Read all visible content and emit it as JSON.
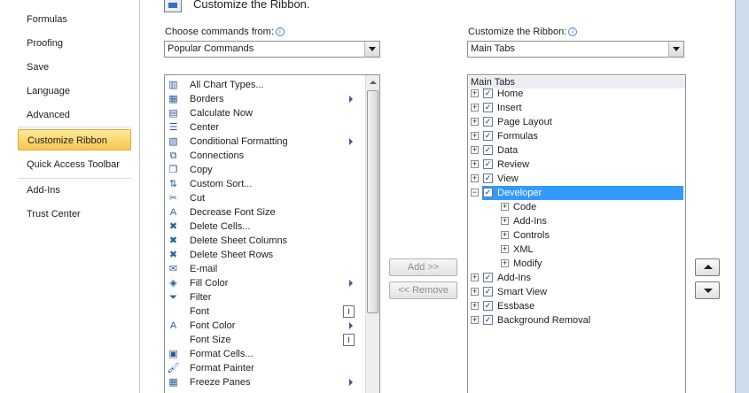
{
  "nav": {
    "items": [
      {
        "label": "Formulas"
      },
      {
        "label": "Proofing"
      },
      {
        "label": "Save"
      },
      {
        "label": "Language"
      },
      {
        "label": "Advanced"
      },
      {
        "label": "Customize Ribbon"
      },
      {
        "label": "Quick Access Toolbar"
      },
      {
        "label": "Add-Ins"
      },
      {
        "label": "Trust Center"
      }
    ]
  },
  "header": {
    "title": "Customize the Ribbon."
  },
  "left": {
    "label": "Choose commands from:",
    "combo_value": "Popular Commands",
    "commands": [
      {
        "label": "All Chart Types...",
        "icon": "chart-icon",
        "glyph": "▥",
        "suffix": ""
      },
      {
        "label": "Borders",
        "icon": "borders-icon",
        "glyph": "▦",
        "suffix": "arrow"
      },
      {
        "label": "Calculate Now",
        "icon": "calculator-icon",
        "glyph": "▤",
        "suffix": ""
      },
      {
        "label": "Center",
        "icon": "center-align-icon",
        "glyph": "☰",
        "suffix": ""
      },
      {
        "label": "Conditional Formatting",
        "icon": "conditional-formatting-icon",
        "glyph": "▧",
        "suffix": "arrow"
      },
      {
        "label": "Connections",
        "icon": "connections-icon",
        "glyph": "⧉",
        "suffix": ""
      },
      {
        "label": "Copy",
        "icon": "copy-icon",
        "glyph": "❐",
        "suffix": ""
      },
      {
        "label": "Custom Sort...",
        "icon": "sort-icon",
        "glyph": "⇅",
        "suffix": ""
      },
      {
        "label": "Cut",
        "icon": "scissors-icon",
        "glyph": "✂",
        "suffix": ""
      },
      {
        "label": "Decrease Font Size",
        "icon": "decrease-font-icon",
        "glyph": "A",
        "suffix": ""
      },
      {
        "label": "Delete Cells...",
        "icon": "delete-cells-icon",
        "glyph": "✖",
        "suffix": ""
      },
      {
        "label": "Delete Sheet Columns",
        "icon": "delete-columns-icon",
        "glyph": "✖",
        "suffix": ""
      },
      {
        "label": "Delete Sheet Rows",
        "icon": "delete-rows-icon",
        "glyph": "✖",
        "suffix": ""
      },
      {
        "label": "E-mail",
        "icon": "email-icon",
        "glyph": "✉",
        "suffix": ""
      },
      {
        "label": "Fill Color",
        "icon": "fill-color-icon",
        "glyph": "◈",
        "suffix": "arrow"
      },
      {
        "label": "Filter",
        "icon": "filter-icon",
        "glyph": "⏷",
        "suffix": ""
      },
      {
        "label": "Font",
        "icon": "font-icon",
        "glyph": "",
        "suffix": "box"
      },
      {
        "label": "Font Color",
        "icon": "font-color-icon",
        "glyph": "A",
        "suffix": "arrow"
      },
      {
        "label": "Font Size",
        "icon": "font-size-icon",
        "glyph": "",
        "suffix": "box"
      },
      {
        "label": "Format Cells...",
        "icon": "format-cells-icon",
        "glyph": "▣",
        "suffix": ""
      },
      {
        "label": "Format Painter",
        "icon": "paintbrush-icon",
        "glyph": "🖌",
        "suffix": ""
      },
      {
        "label": "Freeze Panes",
        "icon": "freeze-panes-icon",
        "glyph": "▦",
        "suffix": "arrow"
      }
    ]
  },
  "right": {
    "label": "Customize the Ribbon:",
    "combo_value": "Main Tabs",
    "tree_header": "Main Tabs",
    "tabs": [
      {
        "label": "Home",
        "level": 0,
        "expander": "+",
        "checked": true
      },
      {
        "label": "Insert",
        "level": 0,
        "expander": "+",
        "checked": true
      },
      {
        "label": "Page Layout",
        "level": 0,
        "expander": "+",
        "checked": true
      },
      {
        "label": "Formulas",
        "level": 0,
        "expander": "+",
        "checked": true
      },
      {
        "label": "Data",
        "level": 0,
        "expander": "+",
        "checked": true
      },
      {
        "label": "Review",
        "level": 0,
        "expander": "+",
        "checked": true
      },
      {
        "label": "View",
        "level": 0,
        "expander": "+",
        "checked": true
      },
      {
        "label": "Developer",
        "level": 0,
        "expander": "−",
        "checked": true,
        "selected": true
      },
      {
        "label": "Code",
        "level": 1,
        "expander": "+",
        "checked": false
      },
      {
        "label": "Add-Ins",
        "level": 1,
        "expander": "+",
        "checked": false
      },
      {
        "label": "Controls",
        "level": 1,
        "expander": "+",
        "checked": false
      },
      {
        "label": "XML",
        "level": 1,
        "expander": "+",
        "checked": false
      },
      {
        "label": "Modify",
        "level": 1,
        "expander": "+",
        "checked": false
      },
      {
        "label": "Add-Ins",
        "level": 0,
        "expander": "+",
        "checked": true
      },
      {
        "label": "Smart View",
        "level": 0,
        "expander": "+",
        "checked": true
      },
      {
        "label": "Essbase",
        "level": 0,
        "expander": "+",
        "checked": true
      },
      {
        "label": "Background Removal",
        "level": 0,
        "expander": "+",
        "checked": true
      }
    ]
  },
  "buttons": {
    "add": "Add >>",
    "remove": "<< Remove"
  }
}
